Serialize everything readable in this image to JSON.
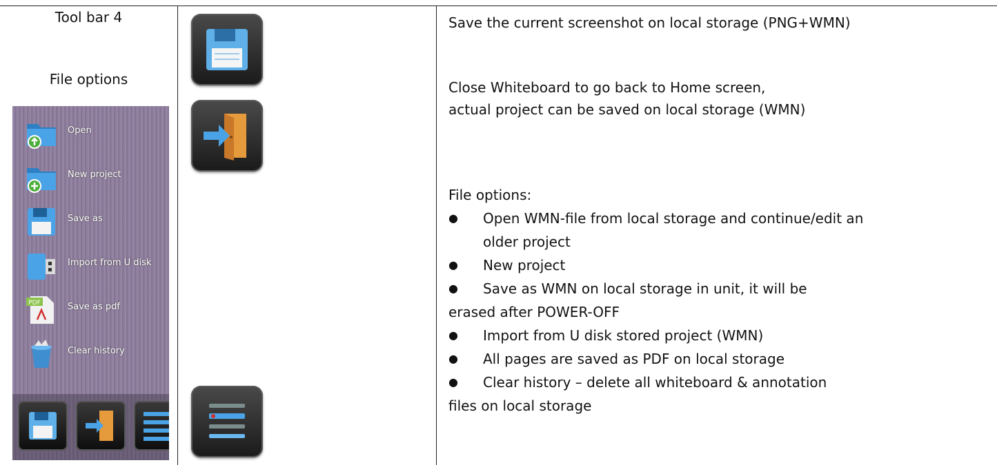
{
  "left_column": {
    "title": "Tool bar 4",
    "subtitle": "File options"
  },
  "device_menu": {
    "items": [
      {
        "label": "Open",
        "icon": "folder-open-icon"
      },
      {
        "label": "New project",
        "icon": "folder-new-icon"
      },
      {
        "label": "Save as",
        "icon": "floppy-disk-icon"
      },
      {
        "label": "Import from U disk",
        "icon": "usb-drive-icon"
      },
      {
        "label": "Save as pdf",
        "icon": "pdf-file-icon"
      },
      {
        "label": "Clear history",
        "icon": "recycle-bin-icon"
      }
    ],
    "dock_icons": [
      "floppy-disk-icon",
      "exit-door-icon",
      "menu-list-icon"
    ]
  },
  "middle_icons": [
    "floppy-disk-icon",
    "exit-door-icon",
    "menu-list-icon"
  ],
  "descriptions": {
    "save": "Save the current screenshot on local storage (PNG+WMN)",
    "close_line1": "Close Whiteboard to go back to Home screen,",
    "close_line2": "actual project can be saved on local storage (WMN)",
    "file_options_heading": "File options:",
    "bullets": {
      "open_1": "Open WMN-file from local storage and continue/edit an",
      "open_2": "older project",
      "new": "New project",
      "save_as_1": "Save as WMN on local storage in unit, it will be",
      "save_as_2": "erased after POWER-OFF",
      "import": "Import from U disk stored project (WMN)",
      "pdf": "All pages are saved as PDF on local storage",
      "clear_1": "Clear history – delete all whiteboard & annotation",
      "clear_2": "files on local storage"
    }
  },
  "colors": {
    "floppy_blue": "#5fb0e8",
    "door_orange": "#e59a3c",
    "folder_blue": "#3f8fd0",
    "plus_green": "#4cae3a"
  }
}
